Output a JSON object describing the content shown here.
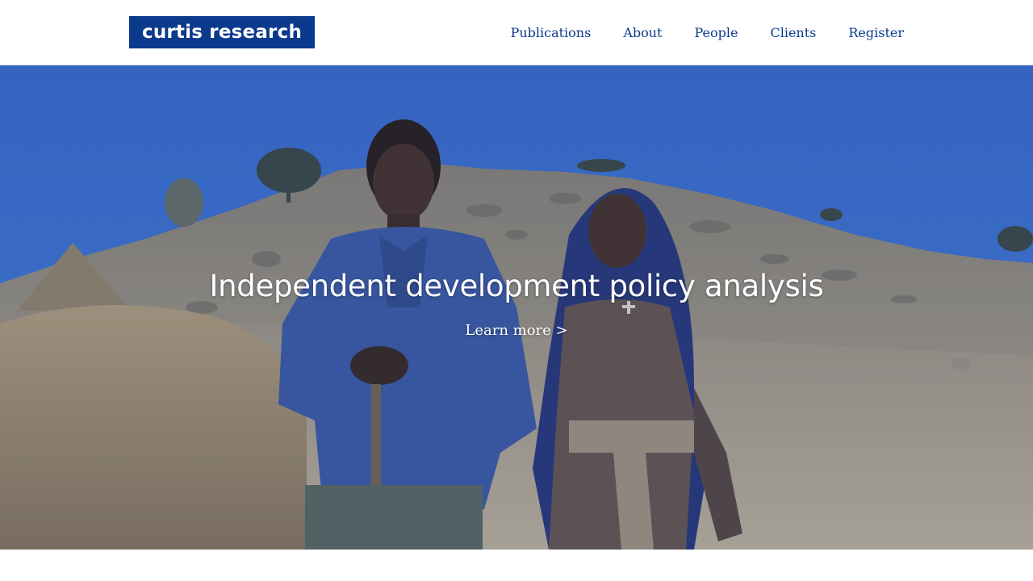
{
  "header": {
    "logo_text": "curtis research",
    "nav": [
      {
        "label": "Publications"
      },
      {
        "label": "About"
      },
      {
        "label": "People"
      },
      {
        "label": "Clients"
      },
      {
        "label": "Register"
      }
    ]
  },
  "hero": {
    "title": "Independent development policy analysis",
    "cta": "Learn more >",
    "image_subject": "two-people-on-hillside-photo"
  },
  "colors": {
    "brand": "#0b3a8c",
    "sky": "#3f78d3",
    "text_on_hero": "#ffffff"
  }
}
